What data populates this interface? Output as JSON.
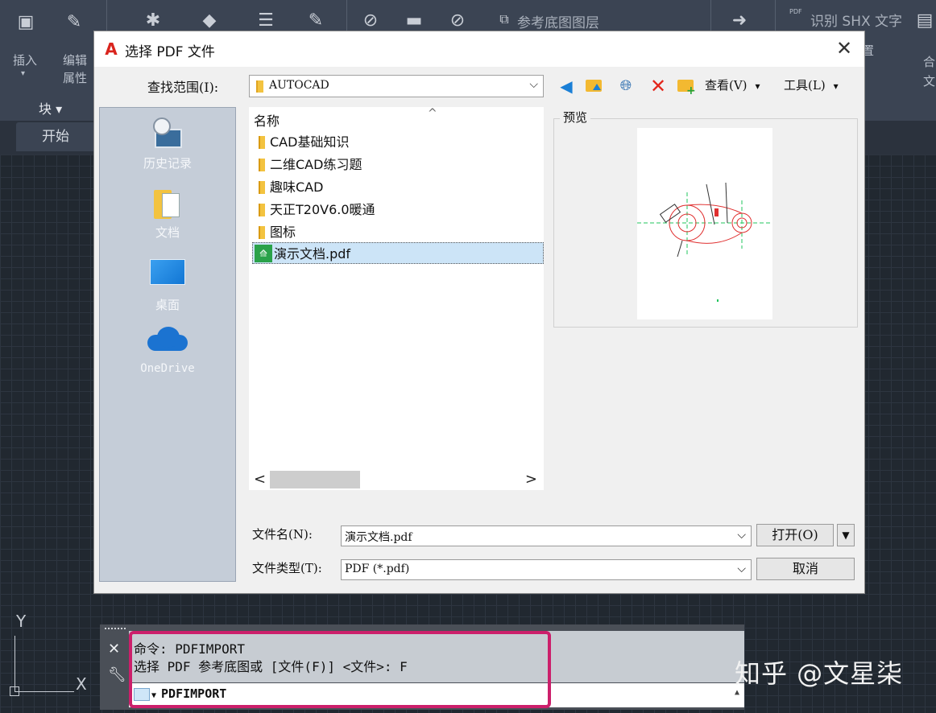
{
  "ribbon": {
    "insert_label": "插入",
    "edit_attr_label": "编辑",
    "attr_label": "属性",
    "block_label": "块 ▾",
    "pdf_layer_label": "参考底图图层",
    "shx_label": "识别 SHX 文字",
    "pdf_badge": "PDF",
    "right_label1": "合",
    "right_label2": "文",
    "partial_label": "置"
  },
  "tabs": {
    "start": "开始"
  },
  "ucs": {
    "y": "Y",
    "x": "X"
  },
  "dialog": {
    "title": "选择 PDF 文件",
    "close": "✕",
    "lookin_label": "查找范围(I):",
    "lookin_value": "AUTOCAD",
    "toolbar": {
      "view_label": "查看(V)",
      "tools_label": "工具(L)"
    },
    "places": [
      {
        "label": "历史记录",
        "icon": "history-icon"
      },
      {
        "label": "文档",
        "icon": "documents-icon"
      },
      {
        "label": "桌面",
        "icon": "desktop-icon"
      },
      {
        "label": "OneDrive",
        "icon": "onedrive-icon"
      }
    ],
    "list_header": "名称",
    "files": [
      {
        "name": "CAD基础知识",
        "type": "folder"
      },
      {
        "name": "二维CAD练习题",
        "type": "folder"
      },
      {
        "name": "趣味CAD",
        "type": "folder"
      },
      {
        "name": "天正T20V6.0暖通",
        "type": "folder"
      },
      {
        "name": "图标",
        "type": "folder"
      },
      {
        "name": "演示文档.pdf",
        "type": "pdf",
        "selected": true
      }
    ],
    "preview_label": "预览",
    "filename_label": "文件名(N):",
    "filename_value": "演示文档.pdf",
    "filetype_label": "文件类型(T):",
    "filetype_value": "PDF (*.pdf)",
    "open_button": "打开(O)",
    "cancel_button": "取消"
  },
  "command": {
    "history_line1": "命令: PDFIMPORT",
    "history_line2": "选择 PDF 参考底图或 [文件(F)] <文件>: F",
    "input_value": "PDFIMPORT"
  },
  "watermark": "知乎 @文星柒",
  "colors": {
    "accent_highlight": "#cc1f6b",
    "selection": "#cce4f7",
    "sidebar": "#c5cdd8"
  }
}
